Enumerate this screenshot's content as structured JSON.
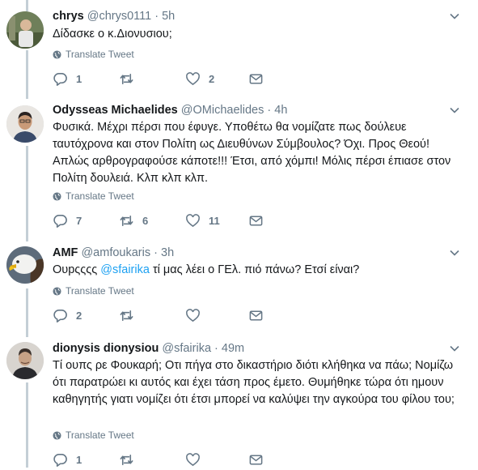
{
  "tweets": [
    {
      "name": "chrys",
      "handle": "@chrys0111",
      "time": "5h",
      "text": "Δίδασκε ο κ.Διονυσιου;",
      "translate_label": "Translate Tweet",
      "reply_count": "1",
      "retweet_count": "",
      "like_count": "2",
      "avatar_icon": "person-photo-icon"
    },
    {
      "name": "Odysseas Michaelides",
      "handle": "@OMichaelides",
      "time": "4h",
      "text": "Φυσικά. Μέχρι πέρσι που έφυγε. Υποθέτω θα νομίζατε πως δούλευε ταυτόχρονα και στον Πολίτη ως Διευθύνων Σύμβουλος? Όχι. Προς Θεού! Απλώς αρθρογραφούσε κάποτε!!! Έτσι, από χόμπι! Μόλις πέρσι έπιασε στον Πολίτη δουλειά. Κλπ κλπ κλπ.",
      "translate_label": "Translate Tweet",
      "reply_count": "7",
      "retweet_count": "6",
      "like_count": "11",
      "avatar_icon": "person-photo-icon"
    },
    {
      "name": "AMF",
      "handle": "@amfoukaris",
      "time": "3h",
      "text_before": "Ουpςςςς ",
      "mention": "@sfairika",
      "text_after": " τί μας λέει ο ΓΕλ. πιό πάνω?   Ετσί είναι?",
      "translate_label": "Translate Tweet",
      "reply_count": "2",
      "retweet_count": "",
      "like_count": "",
      "avatar_icon": "eagle-photo-icon"
    },
    {
      "name": "dionysis dionysiou",
      "handle": "@sfairika",
      "time": "49m",
      "text": "Τί ουπς ρε Φουκαρή; Οτι πήγα στο δικαστήριο διότι κλήθηκα να πάω; Νομίζω ότι παρατρώει κι αυτός και έχει τάση προς έμετο. Θυμήθηκε τώρα ότι ημουν καθηγητής γιατι νομίζει ότι έτσι μπορεί να καλύψει την αγκούρα του φίλου του;",
      "translate_label": "Translate Tweet",
      "reply_count": "1",
      "retweet_count": "",
      "like_count": "",
      "avatar_icon": "person-photo-icon"
    }
  ],
  "separator_dot": "·",
  "colors": {
    "text": "#14171a",
    "secondary": "#657786",
    "link": "#1da1f2",
    "thread_line": "#c4cfd6"
  }
}
